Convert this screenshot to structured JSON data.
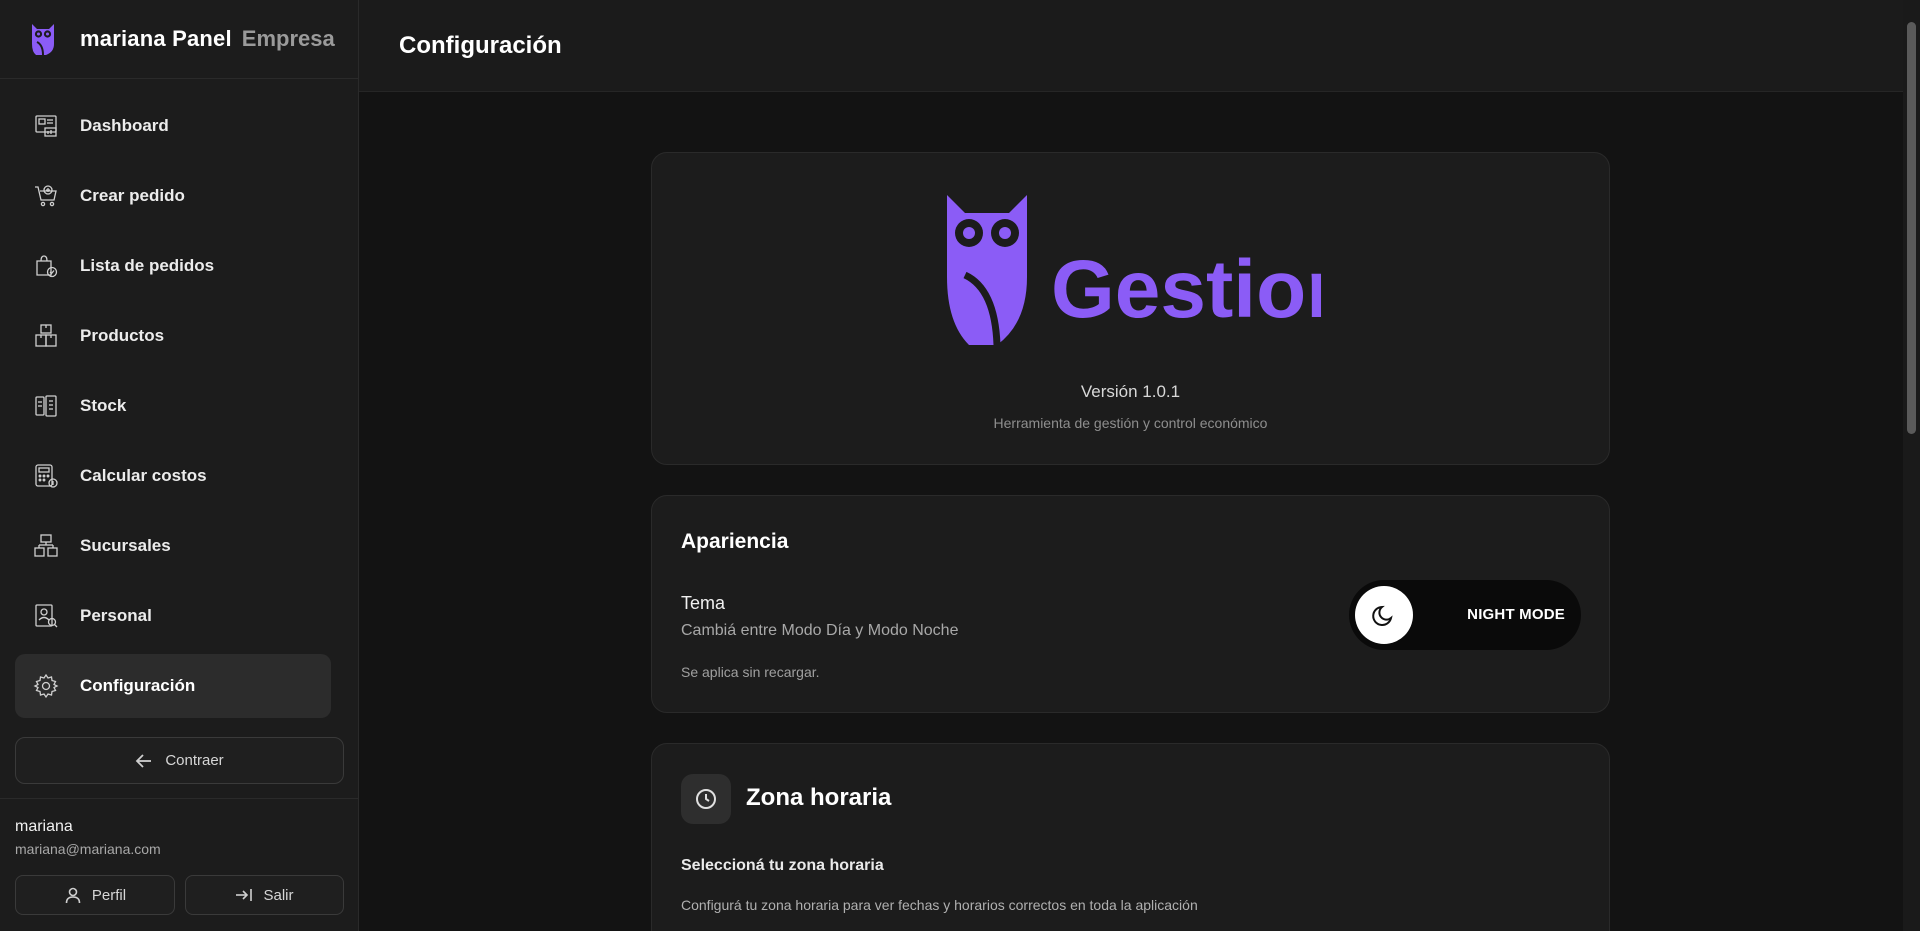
{
  "brand": {
    "title": "mariana Panel",
    "subtitle": "Empresa"
  },
  "sidebar": {
    "items": [
      {
        "label": "Dashboard",
        "icon": "dashboard-icon"
      },
      {
        "label": "Crear pedido",
        "icon": "cart-add-icon"
      },
      {
        "label": "Lista de pedidos",
        "icon": "bag-check-icon"
      },
      {
        "label": "Productos",
        "icon": "boxes-icon"
      },
      {
        "label": "Stock",
        "icon": "stock-icon"
      },
      {
        "label": "Calcular costos",
        "icon": "calculator-icon"
      },
      {
        "label": "Sucursales",
        "icon": "branches-icon"
      },
      {
        "label": "Personal",
        "icon": "id-badge-icon"
      },
      {
        "label": "Configuración",
        "icon": "gear-icon",
        "active": true
      }
    ],
    "collapse_label": "Contraer"
  },
  "user": {
    "name": "mariana",
    "email": "mariana@mariana.com",
    "profile_label": "Perfil",
    "logout_label": "Salir"
  },
  "header": {
    "title": "Configuración"
  },
  "about": {
    "app_name": "Gestior",
    "version": "Versión 1.0.1",
    "tagline": "Herramienta de gestión y control económico",
    "accent": "#8b5cf6"
  },
  "appearance": {
    "title": "Apariencia",
    "theme_label": "Tema",
    "theme_desc": "Cambiá entre Modo Día y Modo Noche",
    "note": "Se aplica sin recargar.",
    "toggle_label": "NIGHT MODE"
  },
  "timezone": {
    "title": "Zona horaria",
    "label": "Seleccioná tu zona horaria",
    "description": "Configurá tu zona horaria para ver fechas y horarios correctos en toda la aplicación"
  }
}
